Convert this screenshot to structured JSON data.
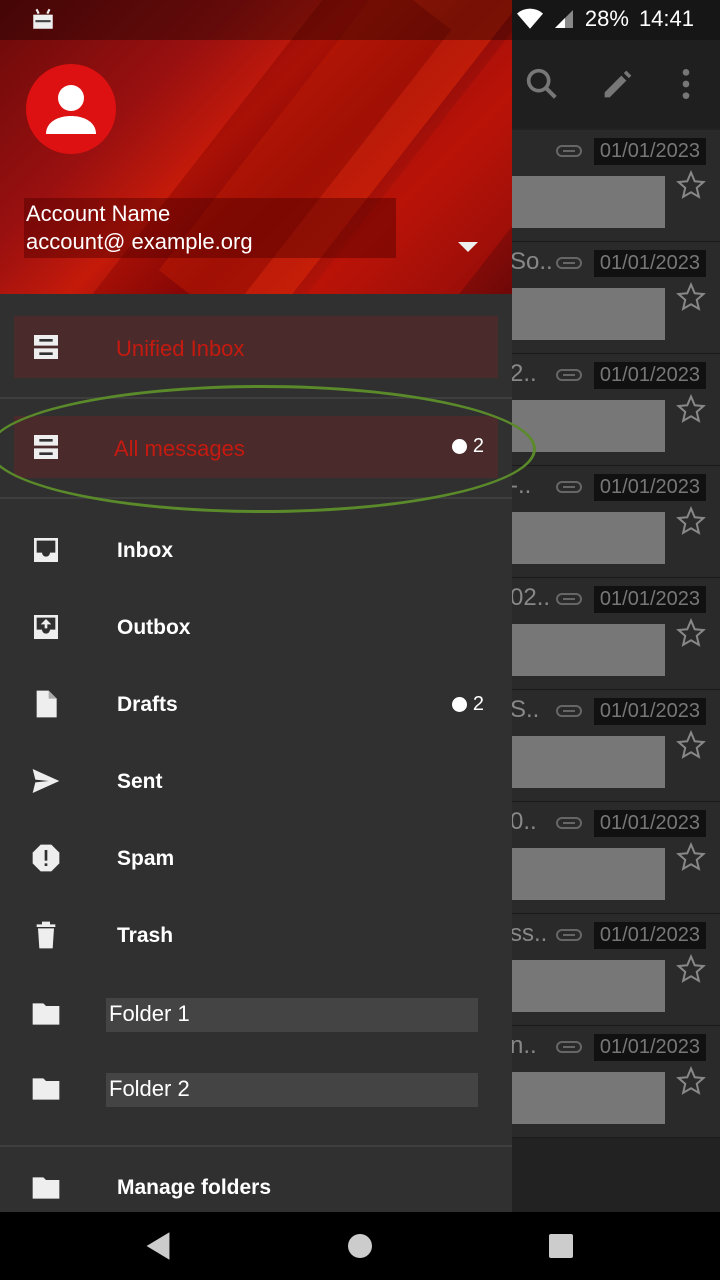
{
  "status": {
    "battery": "28%",
    "time": "14:41"
  },
  "account": {
    "name": "Account Name",
    "email": "account@ example.org"
  },
  "special": [
    {
      "label": "Unified Inbox",
      "icon": "inbox-stack-icon"
    },
    {
      "label": "All messages",
      "icon": "inbox-stack-icon",
      "badge": "2"
    }
  ],
  "folders": [
    {
      "label": "Inbox",
      "icon": "inbox-icon"
    },
    {
      "label": "Outbox",
      "icon": "outbox-icon"
    },
    {
      "label": "Drafts",
      "icon": "drafts-icon",
      "badge": "2"
    },
    {
      "label": "Sent",
      "icon": "send-icon"
    },
    {
      "label": "Spam",
      "icon": "spam-icon"
    },
    {
      "label": "Trash",
      "icon": "trash-icon"
    },
    {
      "label": "Folder 1",
      "icon": "folder-icon"
    },
    {
      "label": "Folder 2",
      "icon": "folder-icon"
    }
  ],
  "manage": {
    "label": "Manage folders",
    "icon": "folder-icon"
  },
  "messages": [
    {
      "snippet": "",
      "date": "01/01/2023"
    },
    {
      "snippet": "So..",
      "date": "01/01/2023"
    },
    {
      "snippet": "2..",
      "date": "01/01/2023"
    },
    {
      "snippet": "-..",
      "date": "01/01/2023"
    },
    {
      "snippet": "02..",
      "date": "01/01/2023"
    },
    {
      "snippet": "S..",
      "date": "01/01/2023"
    },
    {
      "snippet": "0..",
      "date": "01/01/2023"
    },
    {
      "snippet": "ss..",
      "date": "01/01/2023"
    },
    {
      "snippet": "n..",
      "date": "01/01/2023"
    }
  ],
  "colors": {
    "accent": "#c51a10",
    "drawer_bg": "#303030",
    "highlight": "#5a8a2a"
  }
}
